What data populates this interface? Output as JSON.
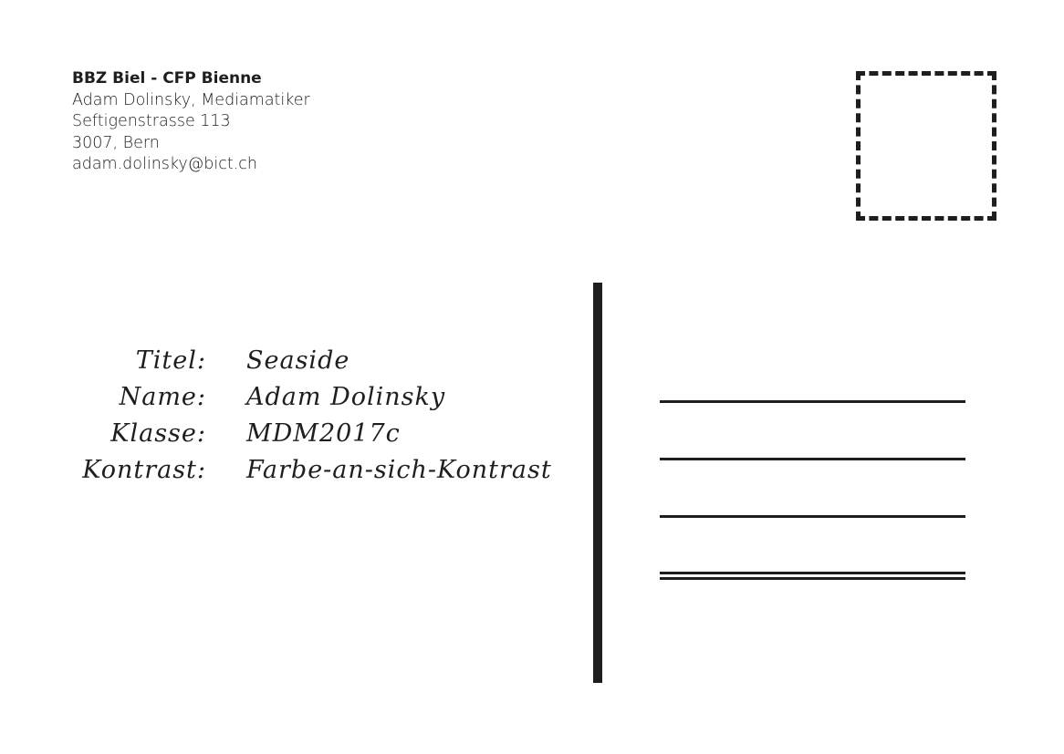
{
  "sender": {
    "organization": "BBZ Biel - CFP Bienne",
    "name_line": "Adam Dolinsky, Mediamatiker",
    "street": "Seftigenstrasse 113",
    "city": "3007, Bern",
    "email": "adam.dolinsky@bict.ch"
  },
  "info": [
    {
      "label": "Titel:",
      "value": "Seaside"
    },
    {
      "label": "Name:",
      "value": "Adam Dolinsky"
    },
    {
      "label": "Klasse:",
      "value": "MDM2017c"
    },
    {
      "label": "Kontrast:",
      "value": "Farbe-an-sich-Kontrast"
    }
  ]
}
